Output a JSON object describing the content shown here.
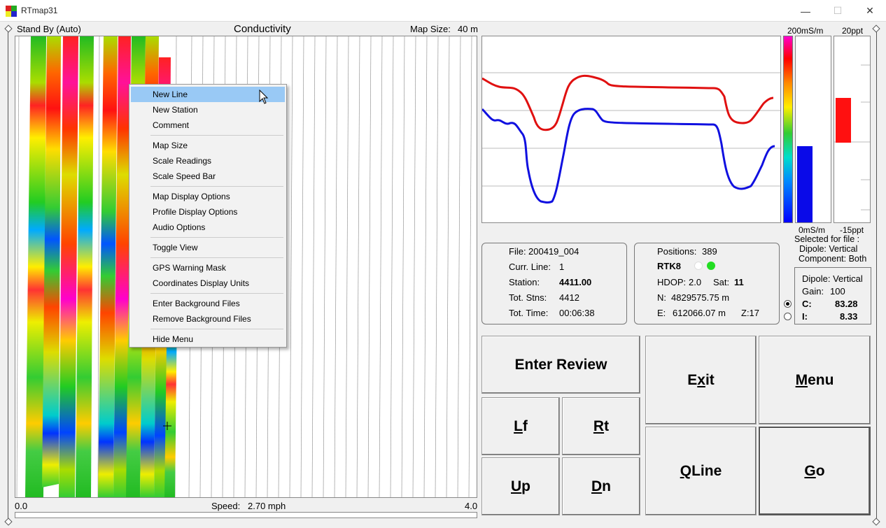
{
  "window": {
    "title": "RTmap31",
    "minimize_glyph": "—",
    "maximize_glyph": "☐",
    "close_glyph": "✕"
  },
  "status": {
    "mode": "Stand By (Auto)",
    "parameter": "Conductivity",
    "map_size_label": "Map Size:",
    "map_size_value": "40 m"
  },
  "speed": {
    "min": "0.0",
    "max": "4.0",
    "label": "Speed:",
    "value": "2.70 mph"
  },
  "scales": {
    "cond_max": "200mS/m",
    "cond_min": "0mS/m",
    "ip_max": "20ppt",
    "ip_min": "-15ppt",
    "cond_level": 0.41,
    "ip_top": 0.67,
    "ip_bottom": 0.43
  },
  "file_selected": {
    "line1": "Selected for file :",
    "line2": "Dipole: Vertical",
    "line3": "Component: Both"
  },
  "file_panel": {
    "file_label": "File:",
    "file_value": "200419_004",
    "line_label": "Curr. Line:",
    "line_value": "1",
    "station_label": "Station:",
    "station_value": "4411.00",
    "tot_stns_label": "Tot. Stns:",
    "tot_stns_value": "4412",
    "tot_time_label": "Tot. Time:",
    "tot_time_value": "00:06:38"
  },
  "gps_panel": {
    "positions_label": "Positions:",
    "positions_value": "389",
    "rtk_label": "RTK8",
    "hdop_label": "HDOP:",
    "hdop_value": "2.0",
    "sat_label": "Sat:",
    "sat_value": "11",
    "n_label": "N:",
    "n_value": "4829575.75 m",
    "e_label": "E:",
    "e_value": "612066.07 m",
    "z_label": "Z:17"
  },
  "dipole_panel": {
    "dipole": "Dipole: Vertical",
    "gain_label": "Gain:",
    "gain_value": "100",
    "c_label": "C:",
    "c_value": "83.28",
    "i_label": "I:",
    "i_value": "8.33"
  },
  "buttons": {
    "enter_review": "Enter Review",
    "exit_prefix": "E",
    "exit_u": "x",
    "exit_rest": "it",
    "menu_u": "M",
    "menu_rest": "enu",
    "lf_u": "L",
    "lf_rest": "f",
    "rt_u": "R",
    "rt_rest": "t",
    "qline_u": "Q",
    "qline_rest": "Line",
    "go_u": "G",
    "go_rest": "o",
    "up_u": "U",
    "up_rest": "p",
    "dn_u": "D",
    "dn_rest": "n"
  },
  "context_menu": [
    {
      "label": "New Line",
      "highlighted": true
    },
    {
      "label": "New Station"
    },
    {
      "label": "Comment"
    },
    {
      "label": "Map Size"
    },
    {
      "label": "Scale Readings"
    },
    {
      "label": "Scale Speed Bar"
    },
    {
      "label": "Map Display Options"
    },
    {
      "label": "Profile Display Options"
    },
    {
      "label": "Audio Options"
    },
    {
      "label": "Toggle View"
    },
    {
      "label": "GPS Warning Mask"
    },
    {
      "label": "Coordinates Display Units"
    },
    {
      "label": "Enter Background Files"
    },
    {
      "label": "Remove Background Files"
    },
    {
      "label": "Hide Menu"
    }
  ],
  "colors": {
    "cond_trace": "#1010e0",
    "ip_trace": "#e01010",
    "menu_highlight": "#99c9f5",
    "gps_led": "#22dd22"
  }
}
